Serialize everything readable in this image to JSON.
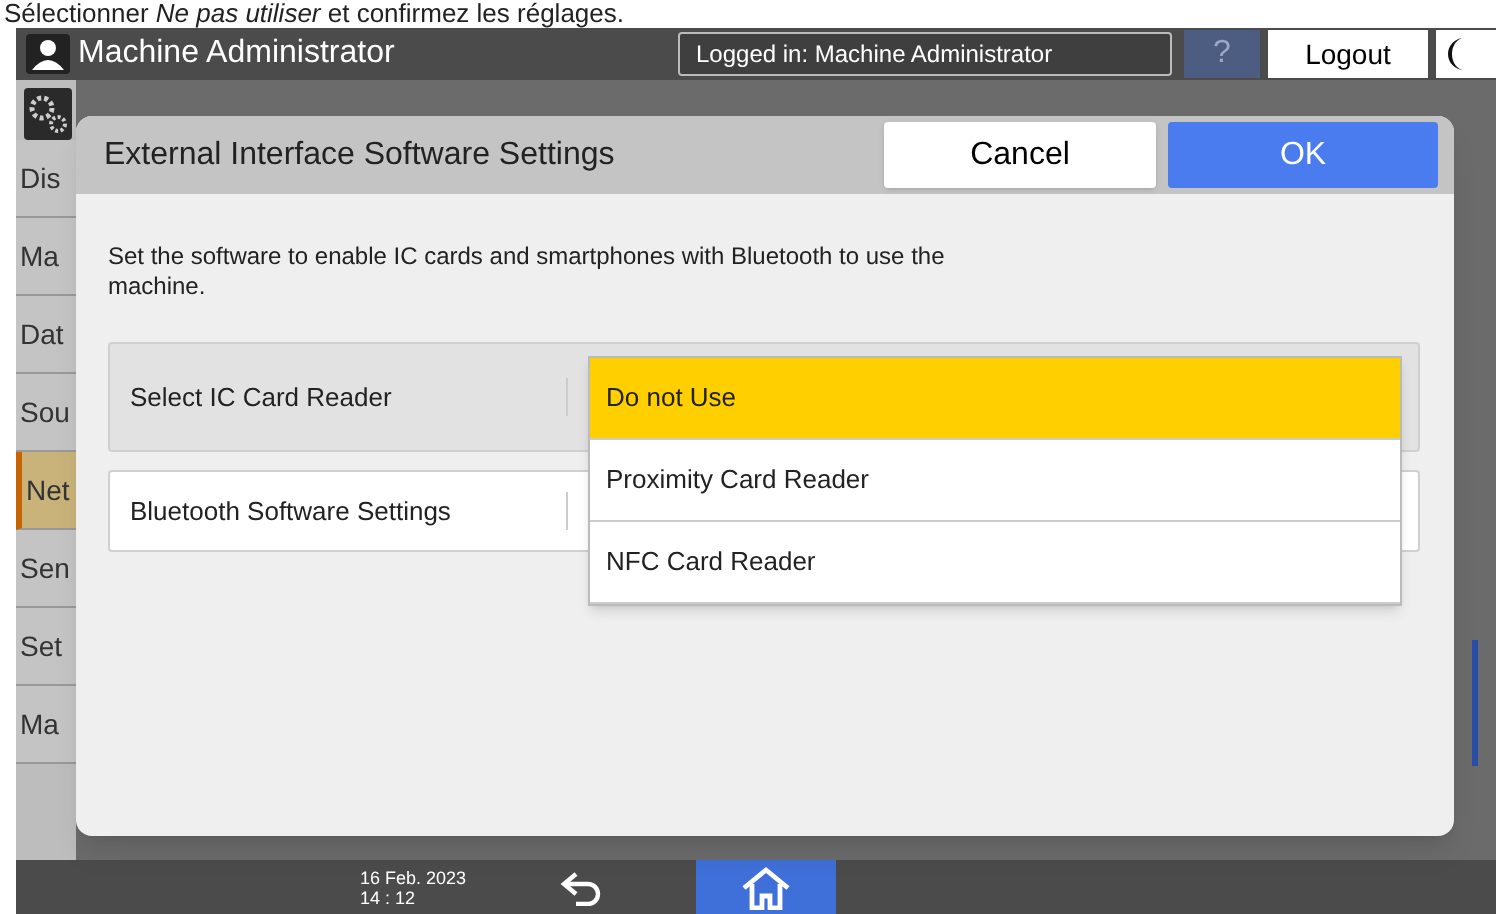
{
  "caption": "Sélectionner *Ne pas utiliser* et confirmez les réglages.",
  "top_bar": {
    "title": "Machine Administrator",
    "login_status": "Logged in: Machine Administrator",
    "help": "?",
    "logout": "Logout"
  },
  "sidebar": {
    "items": [
      {
        "label": "Dis",
        "selected": false
      },
      {
        "label": "Ma",
        "selected": false
      },
      {
        "label": "Dat",
        "selected": false
      },
      {
        "label": "Sou",
        "selected": false
      },
      {
        "label": "Net",
        "selected": true
      },
      {
        "label": "Sen",
        "selected": false
      },
      {
        "label": "Set",
        "selected": false
      },
      {
        "label": "Ma",
        "selected": false
      }
    ]
  },
  "dialog": {
    "title": "External Interface Software Settings",
    "cancel": "Cancel",
    "ok": "OK",
    "description": "Set the software to enable IC cards and smartphones with Bluetooth to use the machine.",
    "rows": [
      {
        "label": "Select IC Card Reader",
        "selected": true
      },
      {
        "label": "Bluetooth Software Settings",
        "selected": false
      }
    ],
    "dropdown": [
      {
        "label": "Do not Use",
        "selected": true
      },
      {
        "label": "Proximity Card Reader",
        "selected": false
      },
      {
        "label": "NFC Card Reader",
        "selected": false
      }
    ]
  },
  "bottom_bar": {
    "date": "16 Feb. 2023",
    "time": "14 : 12"
  }
}
